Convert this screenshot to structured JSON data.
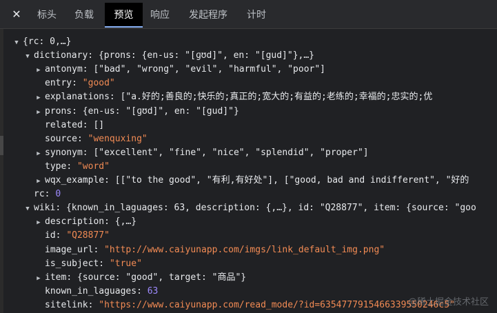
{
  "tabs": [
    {
      "label": "标头"
    },
    {
      "label": "负载"
    },
    {
      "label": "预览"
    },
    {
      "label": "响应"
    },
    {
      "label": "发起程序"
    },
    {
      "label": "计时"
    }
  ],
  "close_glyph": "✕",
  "carets": {
    "expanded": "▼",
    "collapsed": "▶"
  },
  "watermark": "@稀土掘金技术社区",
  "tree": [
    {
      "caret": "expanded",
      "indent": 0,
      "summary": "{rc: 0,…}"
    },
    {
      "caret": "expanded",
      "indent": 1,
      "key": "dictionary",
      "summary": "{prons: {en-us: \"[ɡʊd]\", en: \"[gud]\"},…}"
    },
    {
      "caret": "collapsed",
      "indent": 2,
      "key": "antonym",
      "summary": "[\"bad\", \"wrong\", \"evil\", \"harmful\", \"poor\"]"
    },
    {
      "caret": "none",
      "indent": 2,
      "key": "entry",
      "value": "\"good\"",
      "vtype": "str"
    },
    {
      "caret": "collapsed",
      "indent": 2,
      "key": "explanations",
      "summary": "[\"a.好的;善良的;快乐的;真正的;宽大的;有益的;老练的;幸福的;忠实的;优"
    },
    {
      "caret": "collapsed",
      "indent": 2,
      "key": "prons",
      "summary": "{en-us: \"[ɡʊd]\", en: \"[gud]\"}"
    },
    {
      "caret": "none",
      "indent": 2,
      "key": "related",
      "value": "[]",
      "vtype": "obj"
    },
    {
      "caret": "none",
      "indent": 2,
      "key": "source",
      "value": "\"wenquxing\"",
      "vtype": "str"
    },
    {
      "caret": "collapsed",
      "indent": 2,
      "key": "synonym",
      "summary": "[\"excellent\", \"fine\", \"nice\", \"splendid\", \"proper\"]"
    },
    {
      "caret": "none",
      "indent": 2,
      "key": "type",
      "value": "\"word\"",
      "vtype": "str"
    },
    {
      "caret": "collapsed",
      "indent": 2,
      "key": "wqx_example",
      "summary": "[[\"to the good\", \"有利,有好处\"], [\"good, bad and indifferent\", \"好的"
    },
    {
      "caret": "none",
      "indent": 1,
      "key": "rc",
      "value": "0",
      "vtype": "num"
    },
    {
      "caret": "expanded",
      "indent": 1,
      "key": "wiki",
      "summary": "{known_in_laguages: 63, description: {,…}, id: \"Q28877\", item: {source: \"goo"
    },
    {
      "caret": "collapsed",
      "indent": 2,
      "key": "description",
      "summary": "{,…}"
    },
    {
      "caret": "none",
      "indent": 2,
      "key": "id",
      "value": "\"Q28877\"",
      "vtype": "str"
    },
    {
      "caret": "none",
      "indent": 2,
      "key": "image_url",
      "value": "\"http://www.caiyunapp.com/imgs/link_default_img.png\"",
      "vtype": "str"
    },
    {
      "caret": "none",
      "indent": 2,
      "key": "is_subject",
      "value": "\"true\"",
      "vtype": "str"
    },
    {
      "caret": "collapsed",
      "indent": 2,
      "key": "item",
      "summary": "{source: \"good\", target: \"商品\"}"
    },
    {
      "caret": "none",
      "indent": 2,
      "key": "known_in_laguages",
      "value": "63",
      "vtype": "num"
    },
    {
      "caret": "none",
      "indent": 2,
      "key": "sitelink",
      "value": "\"https://www.caiyunapp.com/read_mode/?id=6354777915466339550246c5\"",
      "vtype": "str"
    }
  ]
}
